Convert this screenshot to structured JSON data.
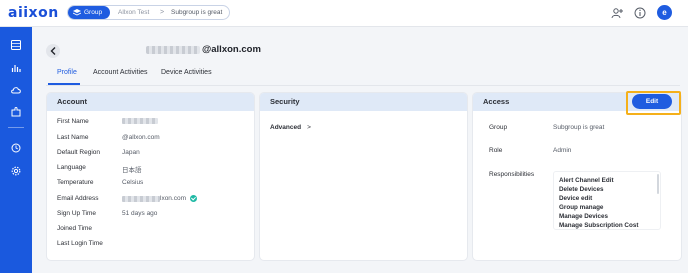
{
  "app": {
    "logo": "aiixon"
  },
  "breadcrumb": {
    "group": "Group",
    "item1": "Allxon Test",
    "separator": ">",
    "item2": "Subgroup is great"
  },
  "user": {
    "avatar_initial": "e",
    "email_domain": "@allxon.com"
  },
  "tabs": [
    {
      "label": "Profile",
      "active": true
    },
    {
      "label": "Account Activities",
      "active": false
    },
    {
      "label": "Device Activities",
      "active": false
    }
  ],
  "account": {
    "title": "Account",
    "fields": [
      {
        "label": "First Name",
        "value": ""
      },
      {
        "label": "Last Name",
        "value": "@allxon.com"
      },
      {
        "label": "Default Region",
        "value": "Japan"
      },
      {
        "label": "Language",
        "value": "日本語"
      },
      {
        "label": "Temperature",
        "value": "Celsius"
      },
      {
        "label": "Email Address",
        "value": "lxon.com"
      },
      {
        "label": "Sign Up Time",
        "value": "51 days ago"
      },
      {
        "label": "Joined Time",
        "value": ""
      },
      {
        "label": "Last Login Time",
        "value": ""
      }
    ]
  },
  "security": {
    "title": "Security",
    "advanced_label": "Advanced",
    "chevron": ">"
  },
  "access": {
    "title": "Access",
    "edit_label": "Edit",
    "group_label": "Group",
    "group_value": "Subgroup is great",
    "role_label": "Role",
    "role_value": "Admin",
    "responsibilities_label": "Responsibilities",
    "responsibilities": [
      "Alert Channel Edit",
      "Delete Devices",
      "Device edit",
      "Group manage",
      "Manage Devices",
      "Manage Subscription Cost"
    ]
  },
  "colors": {
    "accent": "#1f5ce0",
    "sidebar": "#1a59de",
    "highlight": "#f5b01a",
    "card_header": "#dfe9f7"
  }
}
